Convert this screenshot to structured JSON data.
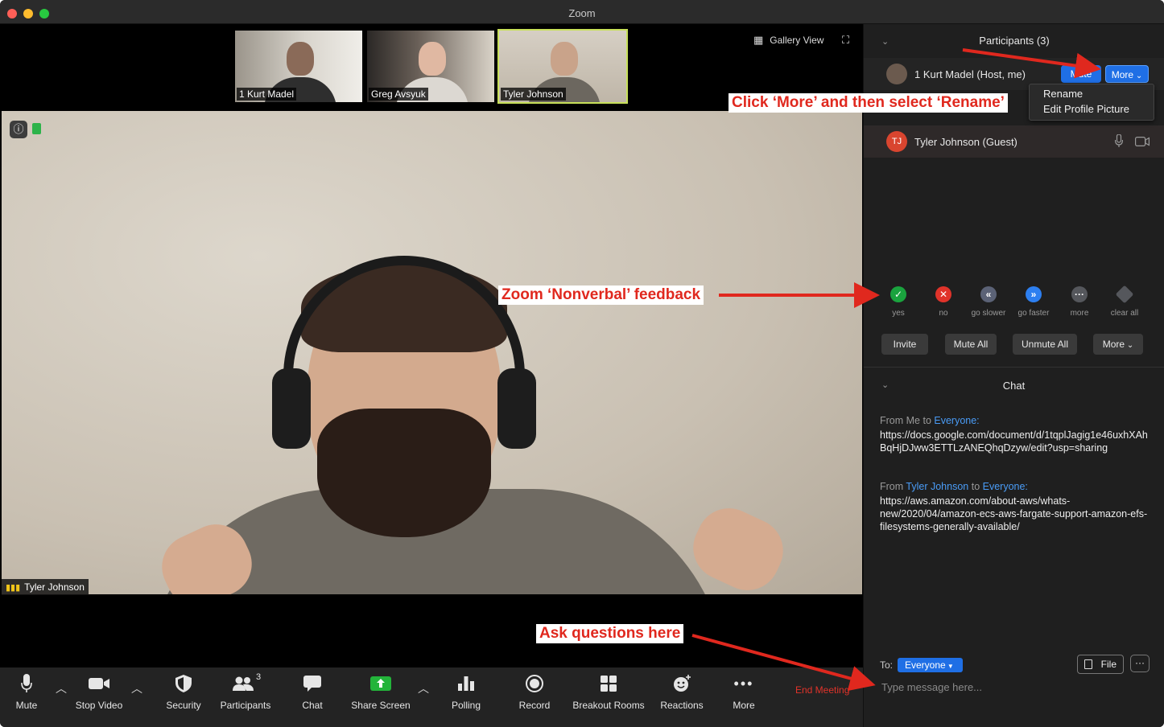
{
  "window": {
    "title": "Zoom",
    "traffic_light_colors": [
      "#ff5f57",
      "#febc2e",
      "#28c840"
    ]
  },
  "thumbnails": [
    {
      "name": "1 Kurt Madel",
      "active": false
    },
    {
      "name": "Greg Avsyuk",
      "active": false
    },
    {
      "name": "Tyler Johnson",
      "active": true
    }
  ],
  "view": {
    "gallery_label": "Gallery View"
  },
  "speaker": {
    "name": "Tyler Johnson"
  },
  "toolbar": {
    "mute": "Mute",
    "stop_video": "Stop Video",
    "security": "Security",
    "participants": "Participants",
    "participants_count": "3",
    "chat": "Chat",
    "share_screen": "Share Screen",
    "polling": "Polling",
    "record": "Record",
    "breakout_rooms": "Breakout Rooms",
    "reactions": "Reactions",
    "more": "More",
    "end_meeting": "End Meeting"
  },
  "participants_panel": {
    "title": "Participants (3)",
    "participants": [
      {
        "name": "1 Kurt Madel (Host, me)",
        "mute_label": "Mute",
        "more_label": "More"
      },
      {
        "name": "Tyler Johnson (Guest)",
        "initials": "TJ"
      }
    ],
    "more_menu": [
      "Rename",
      "Edit Profile Picture"
    ],
    "feedback": [
      {
        "label": "yes",
        "color": "#1aa33e"
      },
      {
        "label": "no",
        "color": "#e0332a"
      },
      {
        "label": "go slower",
        "color": "#5b6276"
      },
      {
        "label": "go faster",
        "color": "#2d7ff0"
      },
      {
        "label": "more",
        "color": "#55575c"
      },
      {
        "label": "clear all",
        "color": "#55575c"
      }
    ],
    "buttons": {
      "invite": "Invite",
      "mute_all": "Mute All",
      "unmute_all": "Unmute All",
      "more": "More"
    }
  },
  "chat": {
    "title": "Chat",
    "messages": [
      {
        "from_prefix": "From Me to ",
        "to": "Everyone:",
        "text": "https://docs.google.com/document/d/1tqplJagig1e46uxhXAhBqHjDJww3ETTLzANEQhqDzyw/edit?usp=sharing"
      },
      {
        "from_prefix": "From ",
        "sender": "Tyler Johnson",
        "to_word": " to ",
        "to": "Everyone:",
        "text": "https://aws.amazon.com/about-aws/whats-new/2020/04/amazon-ecs-aws-fargate-support-amazon-efs-filesystems-generally-available/"
      }
    ],
    "to_label": "To:",
    "recipient": "Everyone",
    "file_button": "File",
    "more_button": "···",
    "input_placeholder": "Type message here..."
  },
  "annotations": {
    "rename": "Click ‘More’ and then select ‘Rename’",
    "feedback": "Zoom ‘Nonverbal’ feedback",
    "questions": "Ask questions here",
    "color": "#e0281e"
  }
}
